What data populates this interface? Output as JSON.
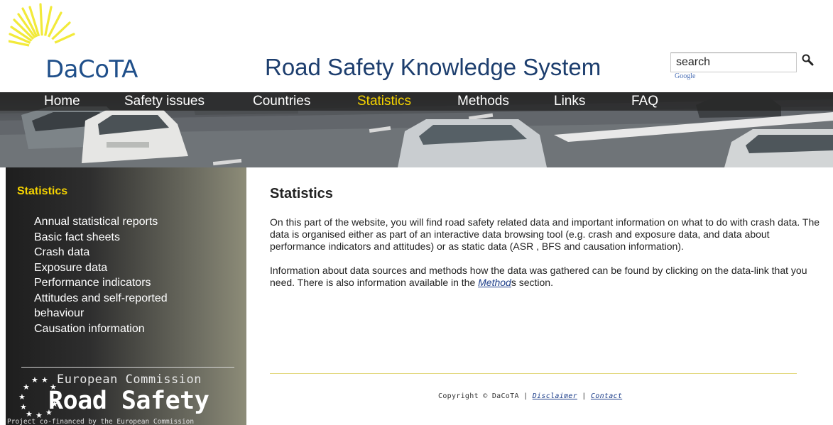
{
  "header": {
    "logo_text": "DaCoTA",
    "site_title": "Road Safety Knowledge System",
    "search_placeholder": "search",
    "search_powered_by": "Google"
  },
  "nav": {
    "items": [
      {
        "label": "Home",
        "active": false
      },
      {
        "label": "Safety issues",
        "active": false
      },
      {
        "label": "Countries",
        "active": false
      },
      {
        "label": "Statistics",
        "active": true
      },
      {
        "label": "Methods",
        "active": false
      },
      {
        "label": "Links",
        "active": false
      },
      {
        "label": "FAQ",
        "active": false
      }
    ]
  },
  "sidebar": {
    "title": "Statistics",
    "items": [
      "Annual statistical reports",
      "Basic fact sheets",
      "Crash data",
      "Exposure data",
      "Performance indicators",
      "Attitudes and self-reported behaviour",
      "Causation information"
    ],
    "ec_logo": {
      "title": "European Commission",
      "subtitle": "Road Safety",
      "funded": "Project co-financed by the European Commission"
    }
  },
  "main": {
    "heading": "Statistics",
    "paragraph1": "On this part of the website, you will find road safety related data and important information on what to do with crash data. The data is organised either as part of an interactive data browsing tool (e.g. crash and exposure data, and data about performance indicators and attitudes) or as static data (ASR , BFS and causation information).",
    "paragraph2_before": "Information about data sources and methods how the data was gathered can be found by clicking on the data-link that you need. There is also information available in the ",
    "paragraph2_link": "Method",
    "paragraph2_after": "s section."
  },
  "footer": {
    "copyright": "Copyright © DaCoTA | ",
    "disclaimer": "Disclaimer",
    "separator": " | ",
    "contact": "Contact"
  },
  "colors": {
    "accent_yellow": "#f5d300",
    "brand_blue": "#1d3e6e",
    "link_blue": "#1d3e8a"
  }
}
